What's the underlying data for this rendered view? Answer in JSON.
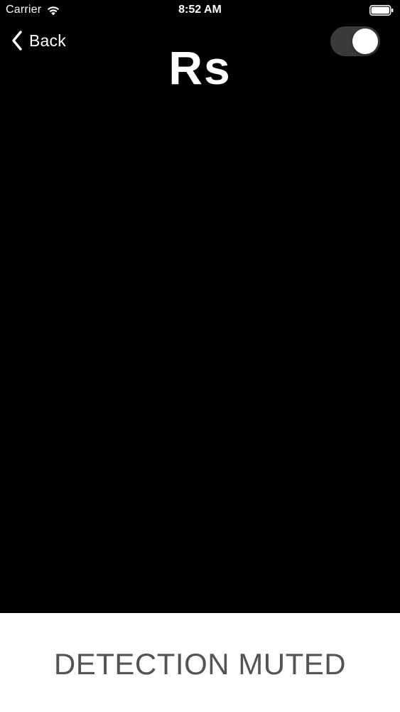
{
  "status_bar": {
    "carrier": "Carrier",
    "time": "8:52 AM",
    "wifi_icon": "wifi-icon",
    "battery_icon": "battery-full-icon"
  },
  "nav": {
    "back_label": "Back",
    "back_icon": "chevron-left-icon",
    "title": "Rs",
    "toggle_on": true
  },
  "detection": {
    "status_text": "DETECTION MUTED"
  },
  "colors": {
    "background": "#000000",
    "panel": "#ffffff",
    "status_text": "#545456",
    "toggle_track": "#3a3a3c"
  }
}
